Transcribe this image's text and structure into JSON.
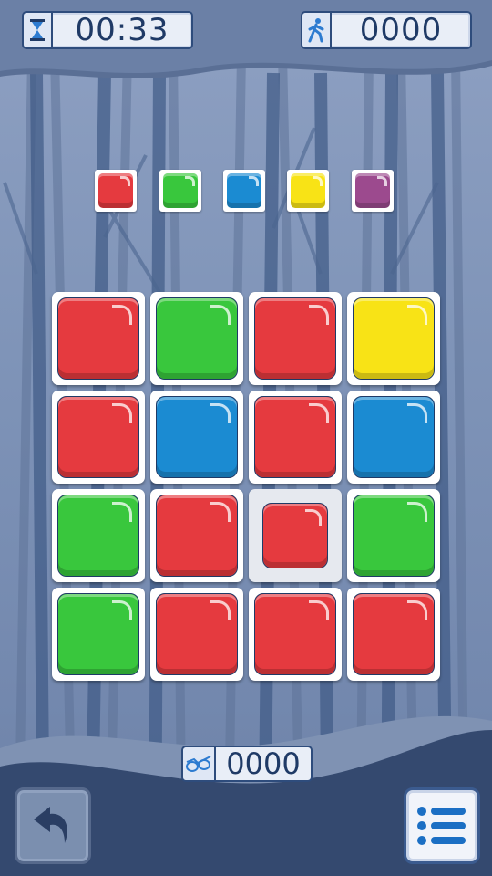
{
  "hud": {
    "timer": {
      "icon": "hourglass-icon",
      "value": "00:33"
    },
    "moves": {
      "icon": "walking-person-icon",
      "value": "0000"
    }
  },
  "palette": [
    "red",
    "green",
    "blue",
    "yellow",
    "purple"
  ],
  "board": {
    "rows": 4,
    "cols": 4,
    "cells": [
      [
        "red",
        "green",
        "red",
        "yellow"
      ],
      [
        "red",
        "blue",
        "red",
        "blue"
      ],
      [
        "green",
        "red",
        "red-selected",
        "green"
      ],
      [
        "green",
        "red",
        "red",
        "red"
      ]
    ]
  },
  "hints": {
    "icon": "glasses-icon",
    "value": "0000"
  },
  "buttons": {
    "undo": "undo-icon",
    "menu": "menu-list-icon"
  },
  "colors": {
    "red": "#e53a3f",
    "green": "#39c73d",
    "blue": "#1b8bd2",
    "yellow": "#f8e316",
    "purple": "#9c4a8e",
    "frame": "#2e4c7c"
  }
}
